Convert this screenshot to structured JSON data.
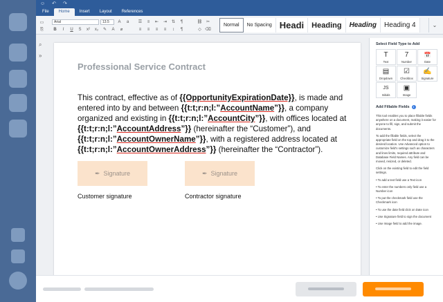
{
  "menubar": {
    "tabs": [
      {
        "label": "File"
      },
      {
        "label": "Home"
      },
      {
        "label": "Insert"
      },
      {
        "label": "Layout"
      },
      {
        "label": "References"
      }
    ],
    "active_tab": "Home"
  },
  "ribbon": {
    "font_family": "Arial",
    "font_size": "13.5",
    "styles": [
      {
        "label": "Normal"
      },
      {
        "label": "No Spacing"
      },
      {
        "label": "Headi"
      },
      {
        "label": "Heading"
      },
      {
        "label": "Heading"
      },
      {
        "label": "Heading 4"
      }
    ]
  },
  "document": {
    "title": "Professional Service Contract",
    "body": {
      "t1": "This contract, effective as of ",
      "f1": "{{OpportunityExpirationDate}}",
      "t2": ", is made and entered into by and between ",
      "f2a": "{{t:t;r:n;l:”",
      "f2b": "AccountName",
      "f2c": "”}}",
      "t3": ", a company organized and existing in ",
      "f3a": "{{t:t;r:n;l:”",
      "f3b": "AccountCity",
      "f3c": "”}}",
      "t4": ", with offices located at ",
      "f4a": "{{t:t;r:n;l:”",
      "f4b": "AccountAddress",
      "f4c": "”}}",
      "t5": " (hereinafter the “Customer”), and ",
      "f5a": "{{t:t;r:n;l:”",
      "f5b": "AccountOwnerName",
      "f5c": "”}}",
      "t6": ", with a registered address located at ",
      "f6a": "{{t:t;r:n;l:”",
      "f6b": "AccountOwnerAddress",
      "f6c": "”}}",
      "t7": " (hereinafter the “Contractor”)."
    },
    "signature_label": "Signature",
    "customer_caption": "Customer signature",
    "contractor_caption": "Contractor signature"
  },
  "panel": {
    "title": "Select Field Type to Add",
    "fields": [
      {
        "label": "Text",
        "icon": "text-icon",
        "glyph": "T"
      },
      {
        "label": "Number",
        "icon": "number-icon",
        "glyph": "7"
      },
      {
        "label": "Date",
        "icon": "calendar-icon",
        "glyph": "📅"
      },
      {
        "label": "Dropdown",
        "icon": "dropdown-icon",
        "glyph": "▤"
      },
      {
        "label": "Checkbox",
        "icon": "checkbox-icon",
        "glyph": "☑"
      },
      {
        "label": "Signature",
        "icon": "signature-icon",
        "glyph": "✍"
      },
      {
        "label": "Initials",
        "icon": "initials-icon",
        "glyph": "JS"
      },
      {
        "label": "Image",
        "icon": "image-icon",
        "glyph": "▣"
      }
    ],
    "add_title": "Add Fillable Fields",
    "help": [
      "This tool enables you to place fillable fields anywhere on a document, making it easier for anyone to fill, sign, and submit the documents.",
      "To add the fillable fields, select the appropriate field on the top and drag it to the desired location. Use Advanced option to customize field's settings such as characters and lines limits, required attribute and Database Field Names. Any field can be moved, resized, or deleted.",
      "Click on the existing field to edit the field settings.",
      "• To add a text field use a Text icon",
      "• To enter the numbers only field use a Number icon",
      "• To put the checkmark field use the Checkmark icon",
      "• To use the date field click on Date icon",
      "• Use Signature field to sign the document",
      "• Use Image field to add the image."
    ]
  },
  "colors": {
    "rail": "#4a6a96",
    "menubar": "#2e5c9a",
    "signature_box": "#fbe3cc",
    "primary_button": "#ff8a00"
  }
}
